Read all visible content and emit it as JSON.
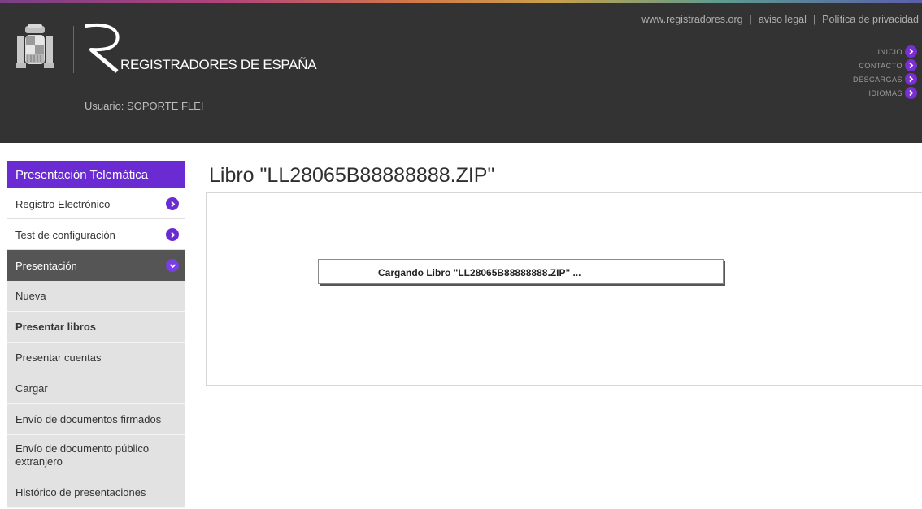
{
  "header": {
    "brand": "REGISTRADORES DE ESPAÑA",
    "user_label": "Usuario:",
    "user_name": "SOPORTE FLEI",
    "top_links": [
      "www.registradores.org",
      "aviso legal",
      "Política de privacidad"
    ],
    "quick_nav": [
      "INICIO",
      "CONTACTO",
      "DESCARGAS",
      "IDIOMAS"
    ]
  },
  "sidebar": {
    "title": "Presentación Telemática",
    "items": [
      "Registro Electrónico",
      "Test de configuración"
    ],
    "active": "Presentación",
    "sub_items": [
      "Nueva",
      "Presentar libros",
      "Presentar cuentas",
      "Cargar",
      "Envío de documentos firmados",
      "Envío de documento público extranjero",
      "Histórico de presentaciones"
    ]
  },
  "main": {
    "title": "Libro \"LL28065B88888888.ZIP\"",
    "loading_text": "Cargando Libro \"LL28065B88888888.ZIP\" ..."
  },
  "colors": {
    "header_bg": "#333333",
    "accent": "#6a2bd3"
  },
  "icons": {
    "crest": "spain-coat-of-arms-icon",
    "logo": "registradores-r-logo",
    "nav_arrow": "chevron-right-circle-icon",
    "active_arrow": "chevron-down-circle-icon"
  }
}
